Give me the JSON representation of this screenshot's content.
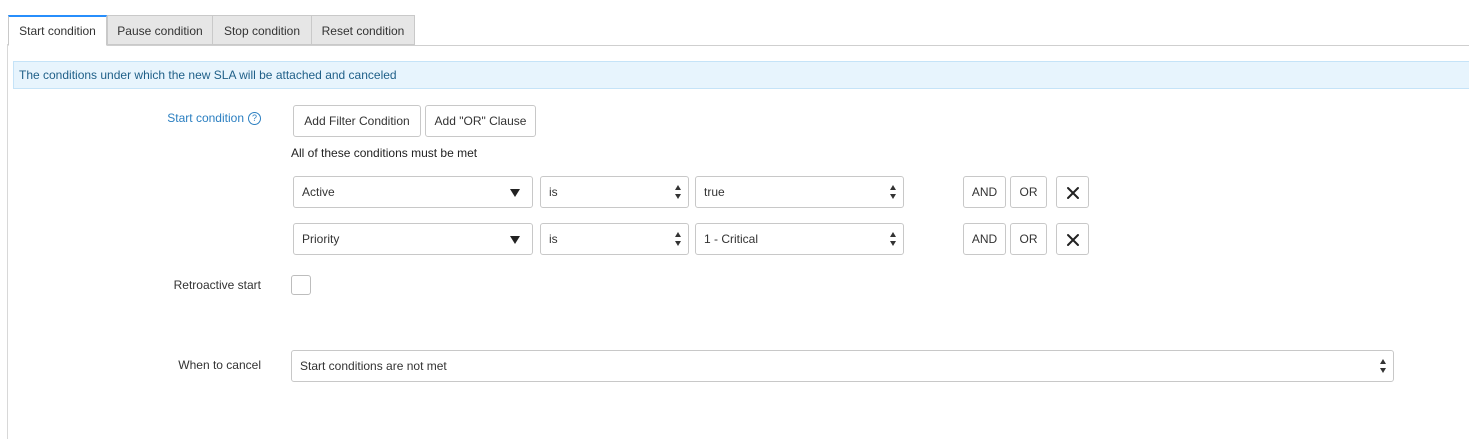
{
  "tabs": [
    {
      "label": "Start condition",
      "active": true
    },
    {
      "label": "Pause condition",
      "active": false
    },
    {
      "label": "Stop condition",
      "active": false
    },
    {
      "label": "Reset condition",
      "active": false
    }
  ],
  "info_message": "The conditions under which the new SLA will be attached and canceled",
  "start_condition": {
    "label": "Start condition",
    "help_icon": "?",
    "add_filter_label": "Add Filter Condition",
    "add_or_label": "Add \"OR\" Clause",
    "hint": "All of these conditions must be met",
    "rows": [
      {
        "field": "Active",
        "operator": "is",
        "value": "true",
        "and_label": "AND",
        "or_label": "OR"
      },
      {
        "field": "Priority",
        "operator": "is",
        "value": "1 - Critical",
        "and_label": "AND",
        "or_label": "OR"
      }
    ]
  },
  "retroactive_start": {
    "label": "Retroactive start",
    "checked": false
  },
  "when_to_cancel": {
    "label": "When to cancel",
    "value": "Start conditions are not met"
  },
  "colors": {
    "accent": "#278efc",
    "info_bg": "#e7f4fd",
    "label_blue": "#2b7fc1"
  }
}
